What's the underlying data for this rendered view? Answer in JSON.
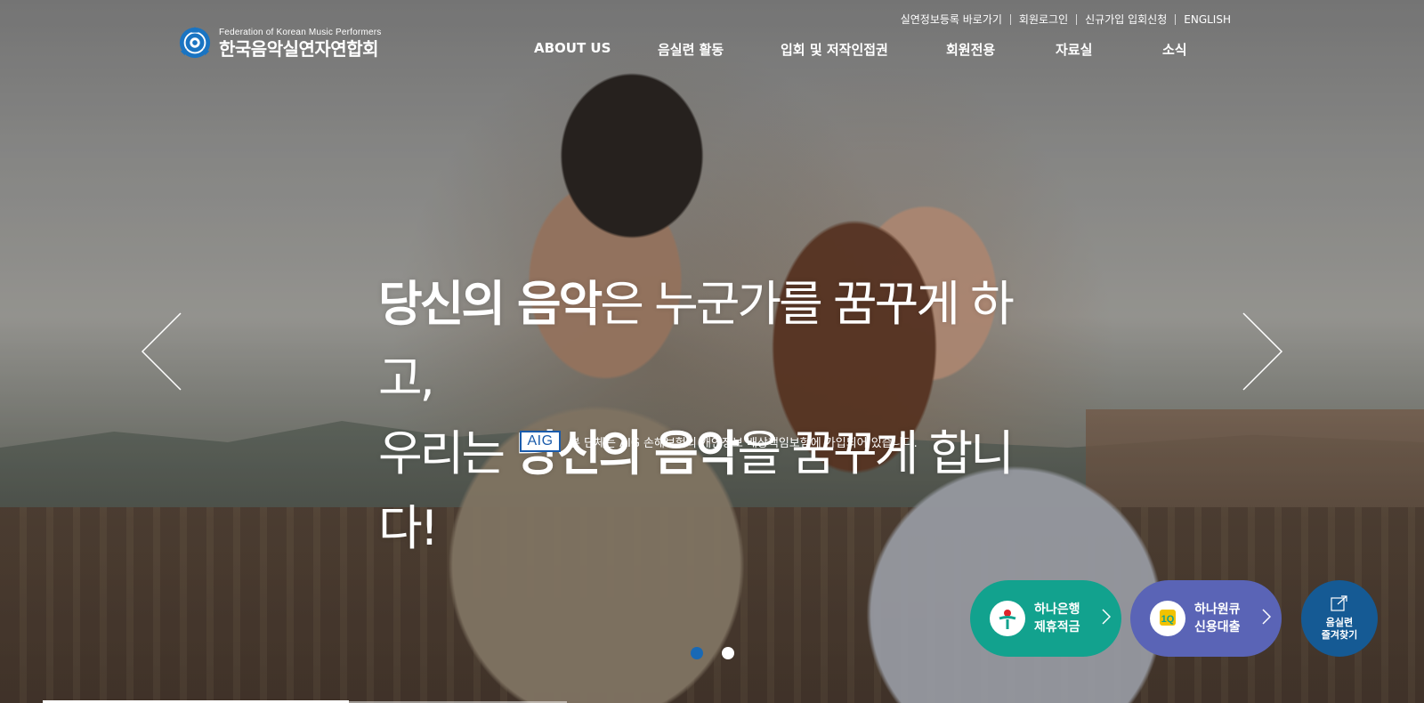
{
  "logo": {
    "english_name": "Federation of Korean Music Performers",
    "korean_name": "한국음악실연자연합회",
    "emblem_color": "#1a74c2"
  },
  "utility_nav": [
    {
      "label": "실연정보등록 바로가기"
    },
    {
      "label": "회원로그인"
    },
    {
      "label": "신규가입 입회신청"
    },
    {
      "label": "ENGLISH"
    }
  ],
  "main_nav": [
    {
      "label": "ABOUT US"
    },
    {
      "label": "음실련 활동"
    },
    {
      "label": "입회 및 저작인접권"
    },
    {
      "label": "회원전용"
    },
    {
      "label": "자료실"
    },
    {
      "label": "소식"
    }
  ],
  "hero": {
    "line1_bold": "당신의 음악",
    "line1_rest": "은 누군가를 꿈꾸게 하고,",
    "line2_start": "우리는 ",
    "line2_bold": "당신의 음악",
    "line2_rest": "을 꿈꾸게 합니다!",
    "aig_logo": "AIG",
    "aig_notice": "본 단체는 AIG 손해보험의 개인정보 배상책임보험에 가입되어 있습니다."
  },
  "slider": {
    "slide_count": 2,
    "active_index": 0,
    "active_color": "#1969b5"
  },
  "quick_links": {
    "hana_bank": {
      "line1": "하나은행",
      "line2": "제휴적금",
      "color": "#12a28e"
    },
    "hana_1q": {
      "line1": "하나원큐",
      "line2": "신용대출",
      "color": "#5a64b6",
      "icon_label": "1Q"
    },
    "bookmark": {
      "line1": "음실련",
      "line2": "즐겨찾기",
      "color": "#155a94"
    }
  }
}
